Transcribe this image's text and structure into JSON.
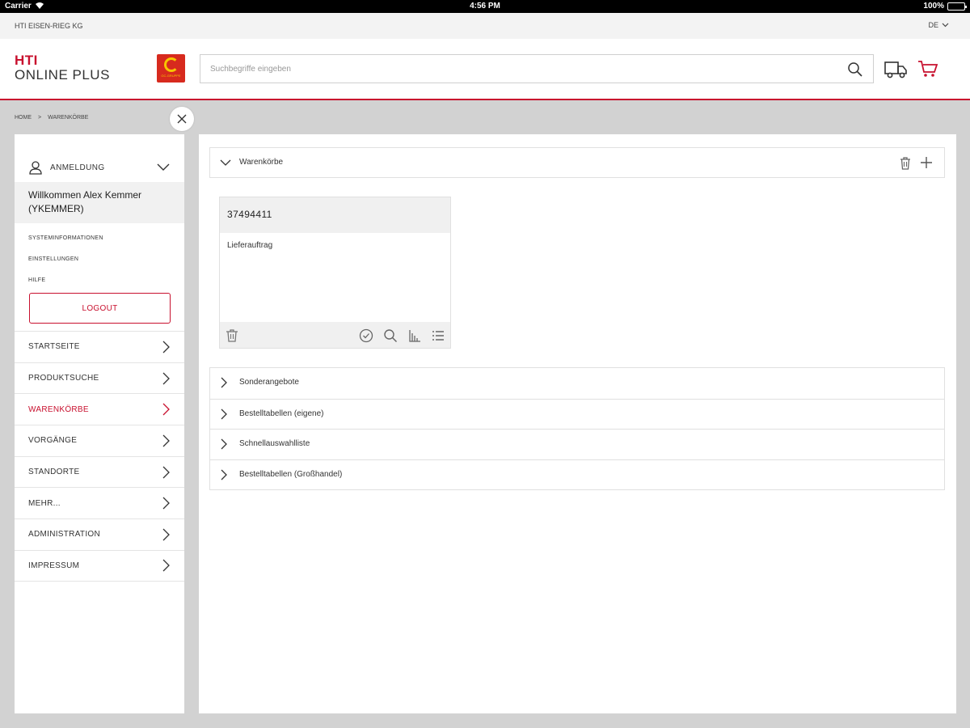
{
  "statusbar": {
    "carrier": "Carrier",
    "time": "4:56 PM",
    "battery": "100%",
    "battery_level": 1.0
  },
  "topstrip": {
    "company": "HTI EISEN-RIEG KG",
    "language": "DE"
  },
  "header": {
    "brand_line1": "HTI",
    "brand_line2": "ONLINE PLUS",
    "logo_text": "GC-GRUPPE",
    "search_placeholder": "Suchbegriffe eingeben"
  },
  "breadcrumb": {
    "home": "HOME",
    "separator": ">",
    "current": "WARENKÖRBE"
  },
  "sidebar": {
    "login_label": "ANMELDUNG",
    "welcome": "Willkommen Alex Kemmer (YKEMMER)",
    "links": [
      "SYSTEMINFORMATIONEN",
      "EINSTELLUNGEN",
      "HILFE"
    ],
    "logout": "LOGOUT",
    "nav": [
      {
        "label": "STARTSEITE",
        "active": false
      },
      {
        "label": "PRODUKTSUCHE",
        "active": false
      },
      {
        "label": "WARENKÖRBE",
        "active": true
      },
      {
        "label": "VORGÄNGE",
        "active": false
      },
      {
        "label": "STANDORTE",
        "active": false
      },
      {
        "label": "MEHR...",
        "active": false
      },
      {
        "label": "ADMINISTRATION",
        "active": false
      },
      {
        "label": "IMPRESSUM",
        "active": false
      }
    ]
  },
  "main": {
    "section_title": "Warenkörbe",
    "card": {
      "number": "37494411",
      "type": "Lieferauftrag"
    },
    "accordion": [
      "Sonderangebote",
      "Bestelltabellen (eigene)",
      "Schnellauswahlliste",
      "Bestelltabellen (Großhandel)"
    ]
  },
  "colors": {
    "brand_red": "#c8102e",
    "logo_red": "#d72a1e",
    "logo_yellow": "#f7c600",
    "background": "#d2d2d2"
  },
  "icons": [
    "wifi-icon",
    "chevron-down-icon",
    "search-icon",
    "truck-icon",
    "cart-icon",
    "close-icon",
    "user-icon",
    "chevron-right-icon",
    "trash-icon",
    "plus-icon",
    "check-circle-icon",
    "sort-icon",
    "list-icon"
  ]
}
